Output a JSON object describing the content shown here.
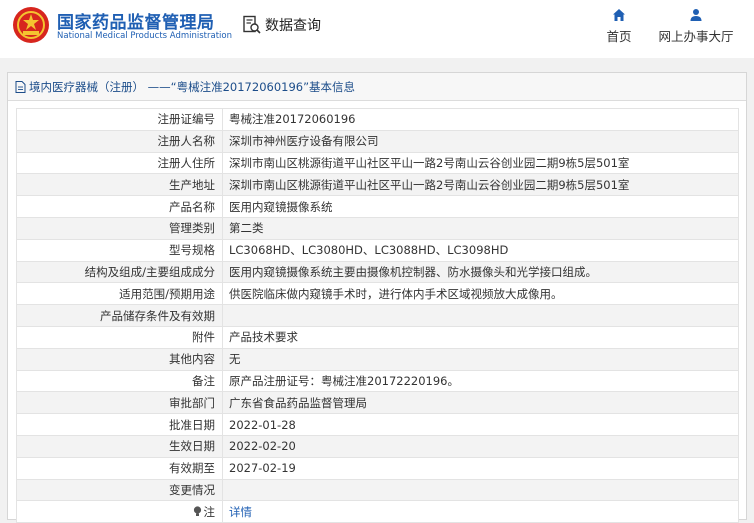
{
  "header": {
    "site_name_cn": "国家药品监督管理局",
    "site_name_en": "National Medical Products Administration",
    "data_query": "数据查询",
    "nav": [
      {
        "label": "首页",
        "icon": "home-icon"
      },
      {
        "label": "网上办事大厅",
        "icon": "user-icon"
      }
    ]
  },
  "panel": {
    "title": "境内医疗器械（注册） ——“粤械注准20172060196”基本信息",
    "rows": [
      {
        "key": "注册证编号",
        "value": "粤械注准20172060196"
      },
      {
        "key": "注册人名称",
        "value": "深圳市神州医疗设备有限公司"
      },
      {
        "key": "注册人住所",
        "value": "深圳市南山区桃源街道平山社区平山一路2号南山云谷创业园二期9栋5层501室"
      },
      {
        "key": "生产地址",
        "value": "深圳市南山区桃源街道平山社区平山一路2号南山云谷创业园二期9栋5层501室"
      },
      {
        "key": "产品名称",
        "value": "医用内窥镜摄像系统"
      },
      {
        "key": "管理类别",
        "value": "第二类"
      },
      {
        "key": "型号规格",
        "value": "LC3068HD、LC3080HD、LC3088HD、LC3098HD"
      },
      {
        "key": "结构及组成/主要组成成分",
        "value": "医用内窥镜摄像系统主要由摄像机控制器、防水摄像头和光学接口组成。"
      },
      {
        "key": "适用范围/预期用途",
        "value": "供医院临床做内窥镜手术时，进行体内手术区域视频放大成像用。"
      },
      {
        "key": "产品储存条件及有效期",
        "value": ""
      },
      {
        "key": "附件",
        "value": "产品技术要求"
      },
      {
        "key": "其他内容",
        "value": "无"
      },
      {
        "key": "备注",
        "value": "原产品注册证号：粤械注准20172220196。"
      },
      {
        "key": "审批部门",
        "value": "广东省食品药品监督管理局"
      },
      {
        "key": "批准日期",
        "value": "2022-01-28"
      },
      {
        "key": "生效日期",
        "value": "2022-02-20"
      },
      {
        "key": "有效期至",
        "value": "2027-02-19"
      },
      {
        "key": "变更情况",
        "value": ""
      }
    ],
    "note_row": {
      "key": "注",
      "link": "详情"
    }
  },
  "colors": {
    "brand_blue": "#1f5fb3",
    "emblem_red": "#d7261e",
    "emblem_gold": "#f4c430"
  }
}
